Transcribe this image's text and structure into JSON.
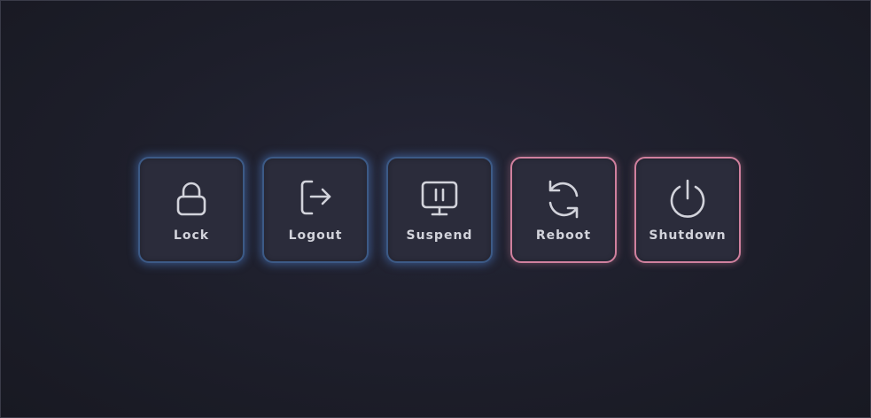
{
  "power_menu": {
    "items": [
      {
        "label": "Lock",
        "icon": "lock-icon",
        "variant": "normal"
      },
      {
        "label": "Logout",
        "icon": "logout-icon",
        "variant": "normal"
      },
      {
        "label": "Suspend",
        "icon": "suspend-icon",
        "variant": "normal"
      },
      {
        "label": "Reboot",
        "icon": "reboot-icon",
        "variant": "danger"
      },
      {
        "label": "Shutdown",
        "icon": "power-icon",
        "variant": "danger"
      }
    ]
  },
  "colors": {
    "background": "#1d1e2a",
    "tile_fill": "#2b2c3b",
    "normal_border": "#3c5a86",
    "normal_glow": "#4a7ac4",
    "danger_border": "#d0809e",
    "icon_stroke": "#d2d3db",
    "label_text": "#d2d3db"
  }
}
